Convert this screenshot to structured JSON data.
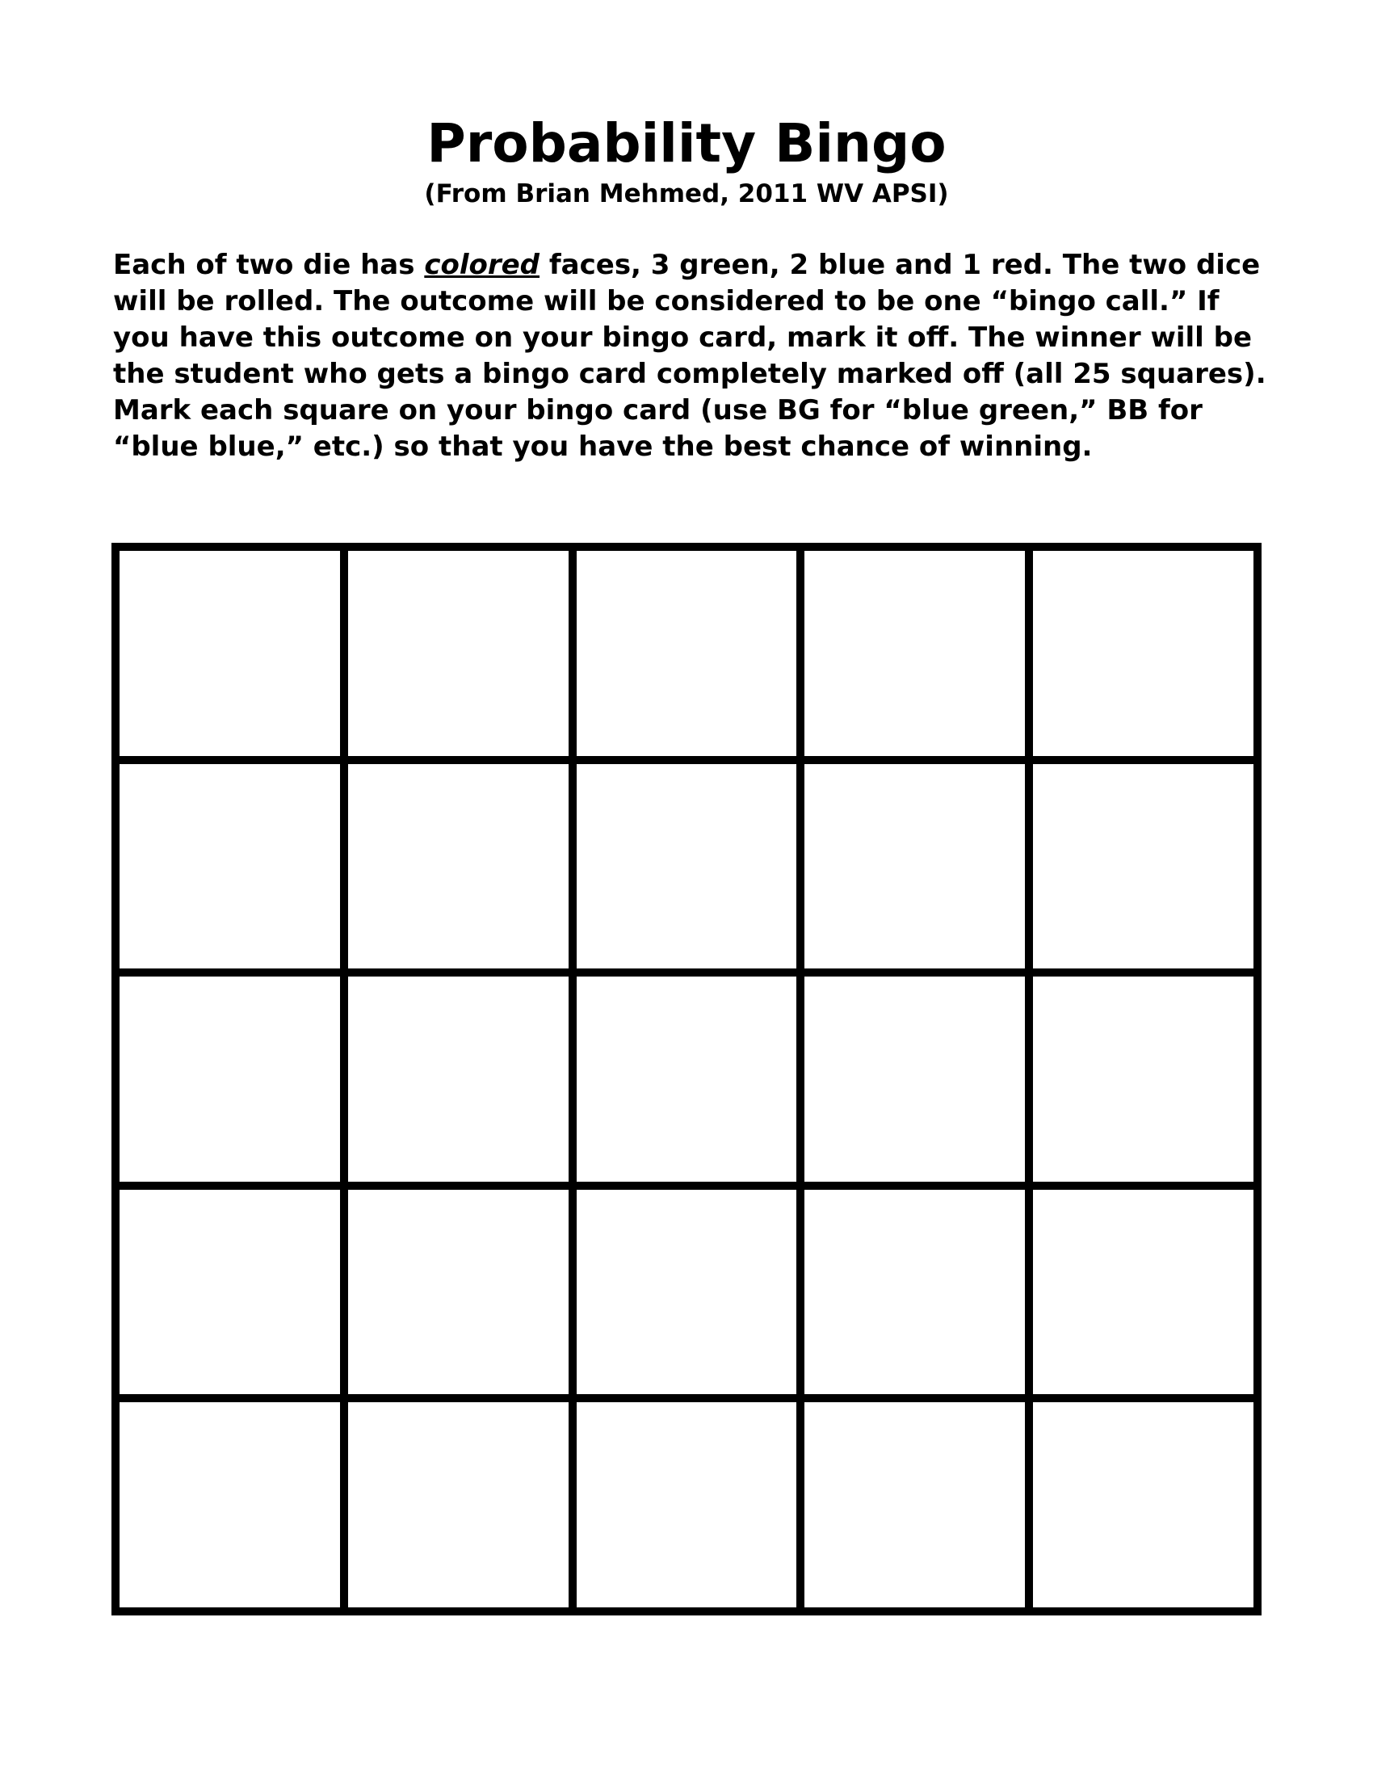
{
  "document": {
    "title": "Probability Bingo",
    "subtitle": "(From Brian Mehmed, 2011 WV APSI)",
    "instructions": {
      "before_emphasis": "Each of two die has ",
      "emphasis": "colored",
      "after_emphasis": " faces, 3 green, 2 blue and 1 red. The two dice will be rolled. The outcome will be considered to be one “bingo call.” If you have this outcome on your bingo card, mark it off. The winner will be the student who gets a bingo card completely marked off (all 25 squares). Mark each square on your bingo card (use BG for “blue green,” BB for “blue blue,” etc.) so that you have the best chance of winning."
    }
  },
  "bingo_card": {
    "rows": 5,
    "columns": 5,
    "cells": [
      "",
      "",
      "",
      "",
      "",
      "",
      "",
      "",
      "",
      "",
      "",
      "",
      "",
      "",
      "",
      "",
      "",
      "",
      "",
      "",
      "",
      "",
      "",
      "",
      ""
    ]
  }
}
